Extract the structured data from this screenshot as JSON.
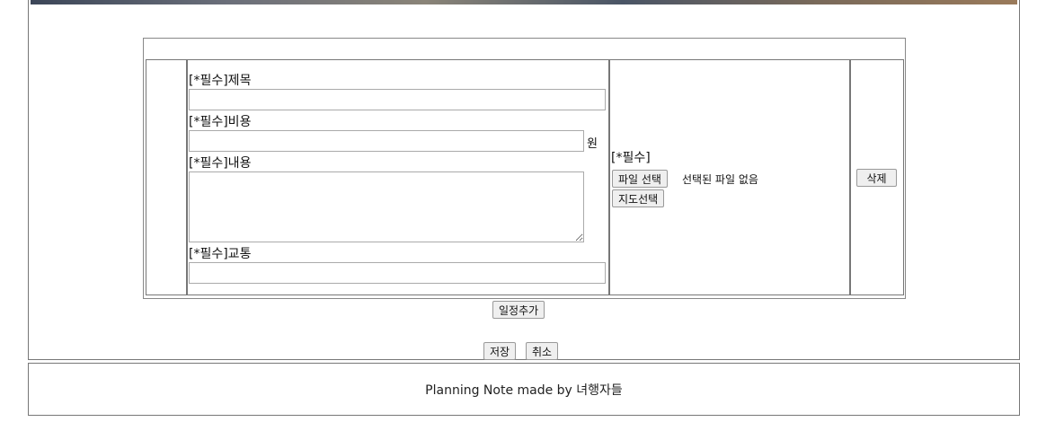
{
  "form": {
    "title_label": "[*필수]제목",
    "title_value": "",
    "cost_label": "[*필수]비용",
    "cost_value": "",
    "cost_unit": "원",
    "content_label": "[*필수]내용",
    "content_value": "",
    "transport_label": "[*필수]교통",
    "transport_value": ""
  },
  "file": {
    "label": "[*필수]",
    "choose_button": "파일 선택",
    "no_file_text": "선택된 파일 없음",
    "map_button": "지도선택"
  },
  "row": {
    "delete_button": "삭제"
  },
  "actions": {
    "add_schedule": "일정추가",
    "save": "저장",
    "cancel": "취소"
  },
  "footer": {
    "text": "Planning Note made by 녀행자들"
  },
  "colors": {
    "border": "#777777",
    "button_bg": "#efefef"
  }
}
